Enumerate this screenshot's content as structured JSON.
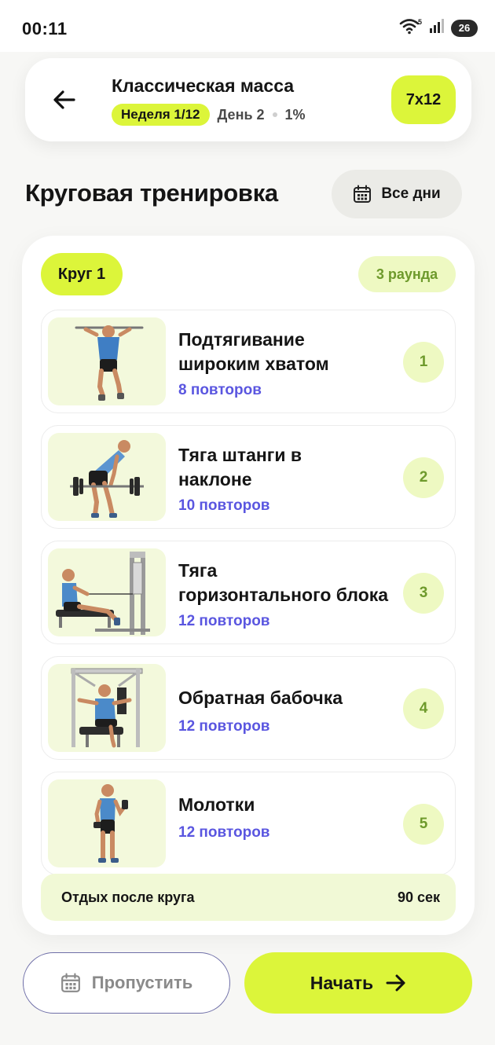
{
  "status": {
    "time": "00:11",
    "battery": "26",
    "wifi_badge": "5"
  },
  "header": {
    "title": "Классическая масса",
    "week": "Неделя 1/12",
    "day": "День 2",
    "progress": "1%",
    "scheme": "7x12"
  },
  "page": {
    "title": "Круговая тренировка",
    "all_days_label": "Все дни"
  },
  "circuit": {
    "label": "Круг 1",
    "rounds": "3 раунда",
    "exercises": [
      {
        "name_line1": "Подтягивание",
        "name_line2": "широким хватом",
        "reps": "8 повторов",
        "number": "1"
      },
      {
        "name_line1": "Тяга штанги в",
        "name_line2": "наклоне",
        "reps": "10 повторов",
        "number": "2"
      },
      {
        "name_line1": "Тяга",
        "name_line2": "горизонтального блока",
        "reps": "12 повторов",
        "number": "3"
      },
      {
        "name_line1": "Обратная бабочка",
        "name_line2": "",
        "reps": "12 повторов",
        "number": "4"
      },
      {
        "name_line1": "Молотки",
        "name_line2": "",
        "reps": "12 повторов",
        "number": "5"
      }
    ],
    "rest_label": "Отдых после круга",
    "rest_value": "90 сек"
  },
  "footer": {
    "skip_label": "Пропустить",
    "start_label": "Начать"
  }
}
